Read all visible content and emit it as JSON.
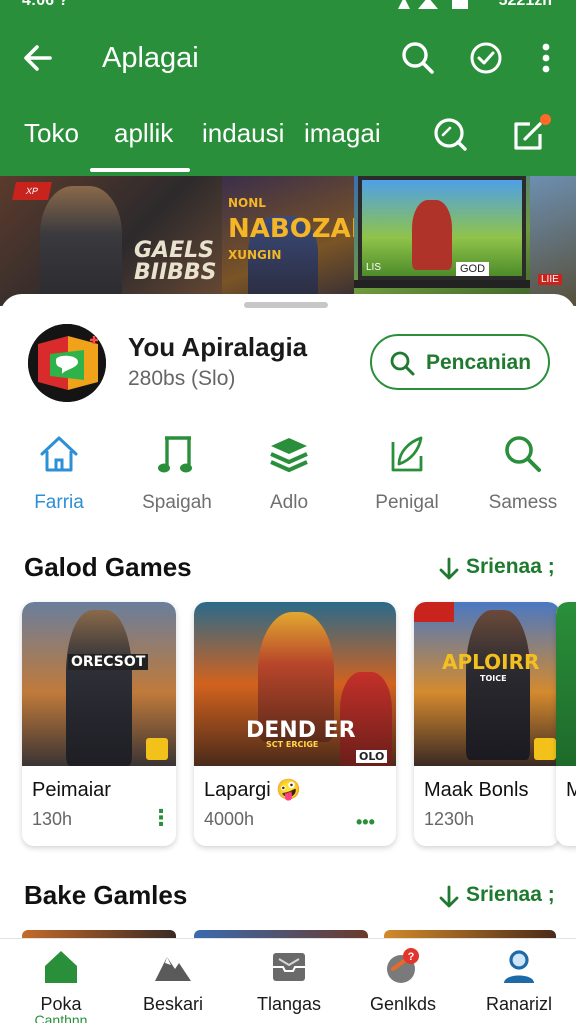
{
  "status_bar": {
    "time": "4:06 ?",
    "right_text": "5221zn"
  },
  "app_bar": {
    "title": "Aplagai"
  },
  "tabs": [
    {
      "label": "Toko",
      "active": false
    },
    {
      "label": "apllik",
      "active": true
    },
    {
      "label": "indausi",
      "active": false
    },
    {
      "label": "imagai",
      "active": false
    }
  ],
  "banner": {
    "text_1": "GAELS",
    "text_2": "BIIBBS",
    "title_1": "NONL",
    "title_2": "NABOZAN",
    "title_3": "XUNGIN",
    "tv_label": "GOD",
    "tv_badge": "LIS",
    "corner_badge": "LIIE"
  },
  "app": {
    "name": "You Apiralagia",
    "subtitle": "280bs (Slo)",
    "search_button": "Pencanian"
  },
  "categories": [
    {
      "label": "Farria",
      "icon": "home-icon",
      "active": true
    },
    {
      "label": "Spaigah",
      "icon": "music-icon",
      "active": false
    },
    {
      "label": "Adlo",
      "icon": "layers-icon",
      "active": false
    },
    {
      "label": "Penigal",
      "icon": "edit-icon",
      "active": false
    },
    {
      "label": "Samess",
      "icon": "search-icon",
      "active": false
    }
  ],
  "section_1": {
    "title": "Galod Games",
    "link": "Srienaa ;"
  },
  "games": [
    {
      "name": "Peimaiar",
      "size": "130h",
      "thumb_title": "ORECSOT"
    },
    {
      "name": "Lapargi 🤪",
      "size": "4000h",
      "thumb_title": "DEND ER",
      "thumb_sub": "SCT ERCIGE",
      "thumb_tag": "OLO"
    },
    {
      "name": "Maak Bonls",
      "size": "1230h",
      "thumb_title": "APLOIRR",
      "thumb_sub": "TOICE"
    },
    {
      "name": "M",
      "size": ""
    }
  ],
  "section_2": {
    "title": "Bake Gamles",
    "link": "Srienaa ;"
  },
  "bottom_nav": [
    {
      "label": "Poka",
      "sub": "Canthnn",
      "icon": "home-icon",
      "active": true
    },
    {
      "label": "Beskari",
      "icon": "mountain-icon",
      "active": false
    },
    {
      "label": "Tlangas",
      "icon": "inbox-icon",
      "active": false
    },
    {
      "label": "Genlkds",
      "icon": "apps-icon",
      "active": false,
      "badge": "?"
    },
    {
      "label": "Ranarizl",
      "icon": "person-icon",
      "active": false
    }
  ],
  "colors": {
    "primary": "#2a8f3a",
    "accent_blue": "#2d8fd6",
    "badge": "#e2362c"
  }
}
